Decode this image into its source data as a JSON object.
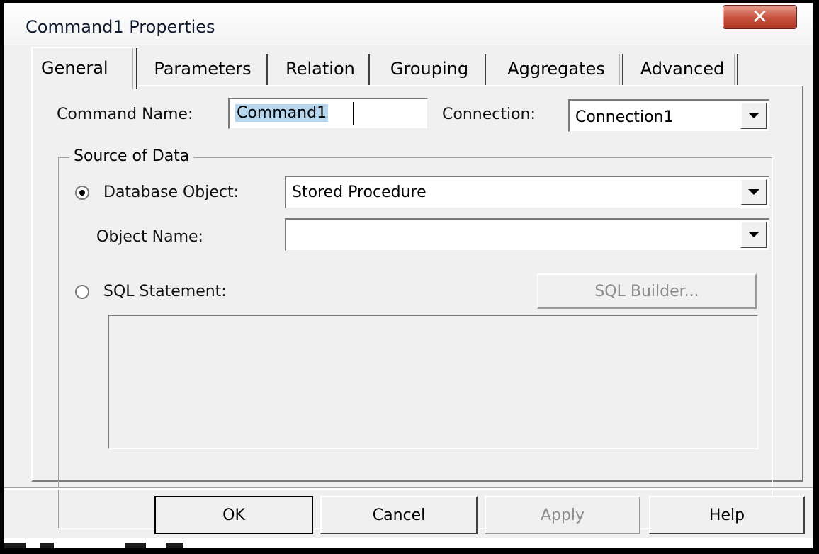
{
  "window": {
    "title": "Command1 Properties",
    "close_label": "✕"
  },
  "tabs": [
    {
      "label": "General",
      "active": true
    },
    {
      "label": "Parameters"
    },
    {
      "label": "Relation"
    },
    {
      "label": "Grouping"
    },
    {
      "label": "Aggregates"
    },
    {
      "label": "Advanced"
    }
  ],
  "general": {
    "command_name_label": "Command Name:",
    "command_name_value": "Command1",
    "connection_label": "Connection:",
    "connection_value": "Connection1"
  },
  "source_of_data": {
    "group_label": "Source of Data",
    "database_object_label": "Database Object:",
    "database_object_value": "Stored Procedure",
    "database_object_selected": true,
    "object_name_label": "Object Name:",
    "object_name_value": "",
    "sql_statement_label": "SQL Statement:",
    "sql_statement_selected": false,
    "sql_builder_label": "SQL Builder...",
    "sql_text": ""
  },
  "footer": {
    "ok_label": "OK",
    "cancel_label": "Cancel",
    "apply_label": "Apply",
    "help_label": "Help"
  },
  "colors": {
    "dialog_bg": "#f0f0f0",
    "close_button": "#c6503d",
    "selection_highlight": "#b7d7ee",
    "disabled_text": "#8c8c8c"
  }
}
